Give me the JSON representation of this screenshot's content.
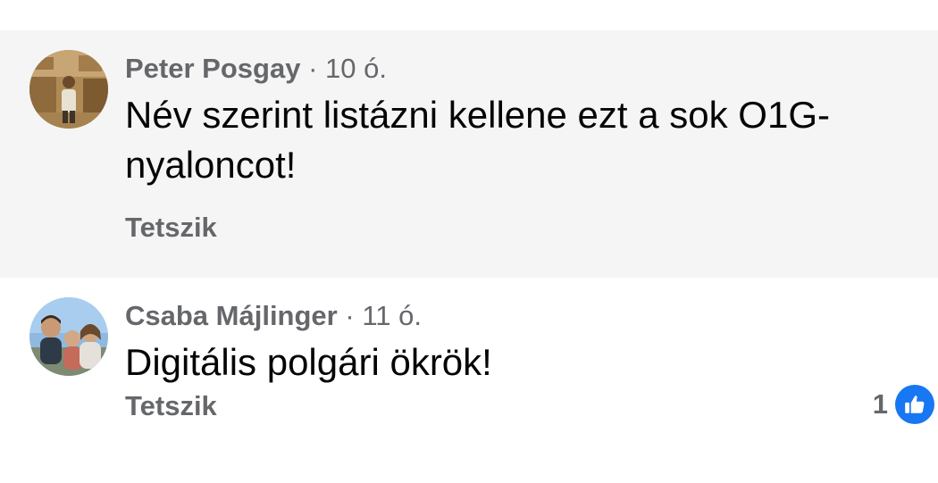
{
  "comments": [
    {
      "author": "Peter Posgay",
      "separator": "·",
      "time": "10 ó.",
      "text": "Név szerint listázni kellene ezt a sok O1G-nyaloncot!",
      "like_label": "Tetszik"
    },
    {
      "author": "Csaba Májlinger",
      "separator": "·",
      "time": "11 ó.",
      "text": "Digitális polgári ökrök!",
      "like_label": "Tetszik",
      "reaction_count": "1",
      "reaction_icon": "thumbs-up-icon"
    }
  ],
  "colors": {
    "meta_gray": "#65676b",
    "text_black": "#050505",
    "highlight_bg": "#f5f5f5",
    "like_blue": "#1877f2"
  }
}
